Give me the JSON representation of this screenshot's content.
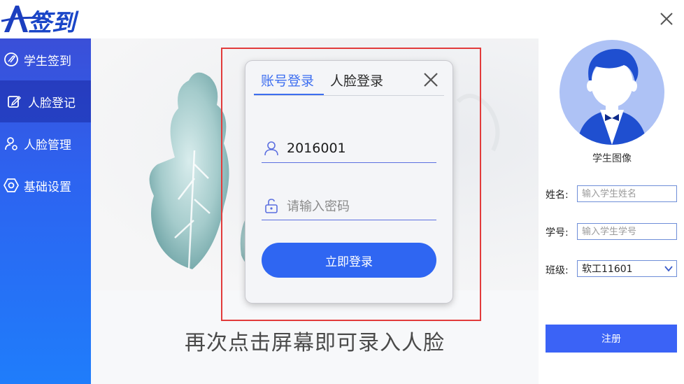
{
  "logo": {
    "text": "A签到"
  },
  "sidebar": {
    "items": [
      {
        "label": "学生签到",
        "icon": "sign-in-icon"
      },
      {
        "label": "人脸登记",
        "icon": "register-form-icon",
        "active": true
      },
      {
        "label": "人脸管理",
        "icon": "user-settings-icon"
      },
      {
        "label": "基础设置",
        "icon": "hexagon-settings-icon"
      }
    ]
  },
  "main": {
    "hint": "再次点击屏幕即可录入人脸"
  },
  "login_dialog": {
    "tab_account": "账号登录",
    "tab_face": "人脸登录",
    "username_value": "2016001",
    "password_placeholder": "请输入密码",
    "login_button": "立即登录"
  },
  "right_panel": {
    "avatar_label": "学生图像",
    "name_label": "姓名:",
    "name_placeholder": "输入学生姓名",
    "id_label": "学号:",
    "id_placeholder": "输入学生学号",
    "class_label": "班级:",
    "class_value": "软工11601",
    "register_button": "注册"
  },
  "colors": {
    "accent": "#2f66f2",
    "sidebar_top": "#3a4fd8",
    "sidebar_bottom": "#1f7dfb",
    "highlight_frame": "#e23b3b"
  }
}
